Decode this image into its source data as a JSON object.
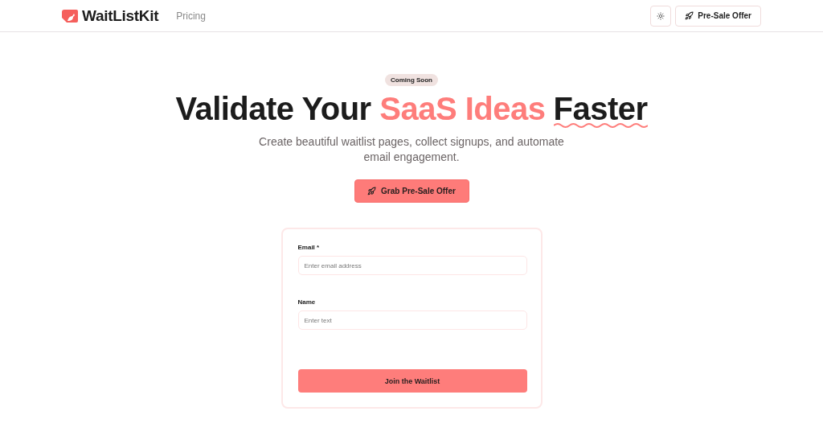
{
  "nav": {
    "brand": "WaitListKit",
    "links": [
      "Pricing"
    ],
    "offer_button": "Pre-Sale Offer"
  },
  "hero": {
    "badge": "Coming Soon",
    "headline": [
      {
        "text": "Validate Your ",
        "kind": "plain"
      },
      {
        "text": "SaaS Ideas",
        "kind": "accent"
      },
      {
        "text": "Faster",
        "kind": "squiggle"
      }
    ],
    "subtitle": "Create beautiful waitlist pages, collect signups, and automate email engagement.",
    "cta": "Grab Pre-Sale Offer"
  },
  "form": {
    "fields": [
      {
        "label": "Email *",
        "placeholder": "Enter email address"
      },
      {
        "label": "Name",
        "placeholder": "Enter text"
      }
    ],
    "submit": "Join the Waitlist"
  }
}
